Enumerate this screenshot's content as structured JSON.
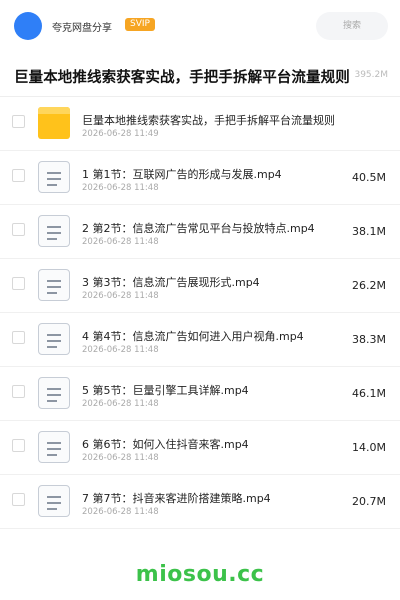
{
  "header": {
    "share_name": "夸克网盘分享",
    "badge": "SVIP",
    "search_placeholder": "搜索"
  },
  "title": {
    "text": "巨量本地推线索获客实战，手把手拆解平台流量规则",
    "total_size": "395.2M"
  },
  "files": [
    {
      "type": "folder",
      "name": "巨量本地推线索获客实战，手把手拆解平台流量规则",
      "date": "2026-06-28 11:49",
      "size": ""
    },
    {
      "type": "file",
      "name": "1 第1节：互联网广告的形成与发展.mp4",
      "date": "2026-06-28 11:48",
      "size": "40.5M"
    },
    {
      "type": "file",
      "name": "2 第2节：信息流广告常见平台与投放特点.mp4",
      "date": "2026-06-28 11:48",
      "size": "38.1M"
    },
    {
      "type": "file",
      "name": "3 第3节：信息流广告展现形式.mp4",
      "date": "2026-06-28 11:48",
      "size": "26.2M"
    },
    {
      "type": "file",
      "name": "4 第4节：信息流广告如何进入用户视角.mp4",
      "date": "2026-06-28 11:48",
      "size": "38.3M"
    },
    {
      "type": "file",
      "name": "5 第5节：巨量引擎工具详解.mp4",
      "date": "2026-06-28 11:48",
      "size": "46.1M"
    },
    {
      "type": "file",
      "name": "6 第6节：如何入住抖音来客.mp4",
      "date": "2026-06-28 11:48",
      "size": "14.0M"
    },
    {
      "type": "file",
      "name": "7 第7节：抖音来客进阶搭建策略.mp4",
      "date": "2026-06-28 11:48",
      "size": "20.7M"
    }
  ],
  "watermark": "miosou.cc",
  "colors": {
    "avatar": "#2f7ff7",
    "svip": "#f6a523",
    "folder": "#ffc21b",
    "watermark": "#3cc24a"
  }
}
